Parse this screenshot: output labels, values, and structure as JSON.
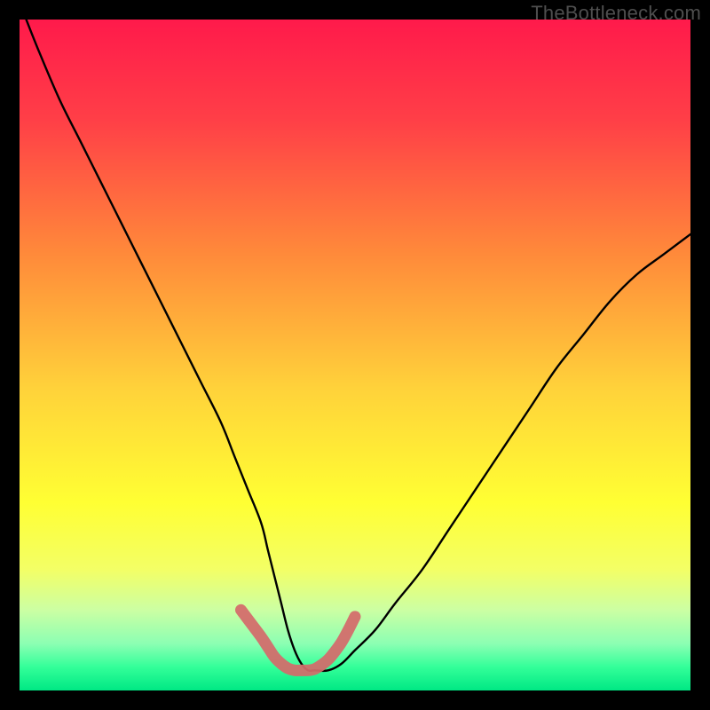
{
  "watermark": "TheBottleneck.com",
  "chart_data": {
    "type": "line",
    "title": "",
    "xlabel": "",
    "ylabel": "",
    "xlim": [
      0,
      100
    ],
    "ylim": [
      0,
      100
    ],
    "grid": false,
    "legend": false,
    "gradient_stops": [
      {
        "offset": 0.0,
        "color": "#ff1a4b"
      },
      {
        "offset": 0.15,
        "color": "#ff3f47"
      },
      {
        "offset": 0.35,
        "color": "#ff8a3a"
      },
      {
        "offset": 0.55,
        "color": "#ffd23a"
      },
      {
        "offset": 0.72,
        "color": "#ffff33"
      },
      {
        "offset": 0.82,
        "color": "#f3ff66"
      },
      {
        "offset": 0.88,
        "color": "#ccffa3"
      },
      {
        "offset": 0.93,
        "color": "#8cffb3"
      },
      {
        "offset": 0.965,
        "color": "#33ff99"
      },
      {
        "offset": 1.0,
        "color": "#00e884"
      }
    ],
    "series": [
      {
        "name": "bottleneck-curve",
        "x": [
          1,
          3,
          6,
          9,
          12,
          15,
          18,
          21,
          24,
          27,
          30,
          32,
          34,
          36,
          37,
          38,
          39,
          40,
          41,
          42,
          43,
          44,
          46,
          48,
          50,
          53,
          56,
          60,
          64,
          68,
          72,
          76,
          80,
          84,
          88,
          92,
          96,
          100
        ],
        "y": [
          100,
          95,
          88,
          82,
          76,
          70,
          64,
          58,
          52,
          46,
          40,
          35,
          30,
          25,
          21,
          17,
          13,
          9,
          6,
          4,
          3,
          3,
          3,
          4,
          6,
          9,
          13,
          18,
          24,
          30,
          36,
          42,
          48,
          53,
          58,
          62,
          65,
          68
        ]
      }
    ],
    "highlight": {
      "name": "minimum-band",
      "color": "#d46a6a",
      "x": [
        33,
        34.5,
        36,
        37,
        38,
        39,
        40,
        41,
        42,
        43,
        44,
        45,
        46,
        47,
        48,
        49,
        50
      ],
      "y": [
        12,
        10,
        8,
        6.5,
        5,
        4,
        3.3,
        3,
        3,
        3,
        3.2,
        3.8,
        4.6,
        5.8,
        7.2,
        9,
        11
      ]
    }
  }
}
